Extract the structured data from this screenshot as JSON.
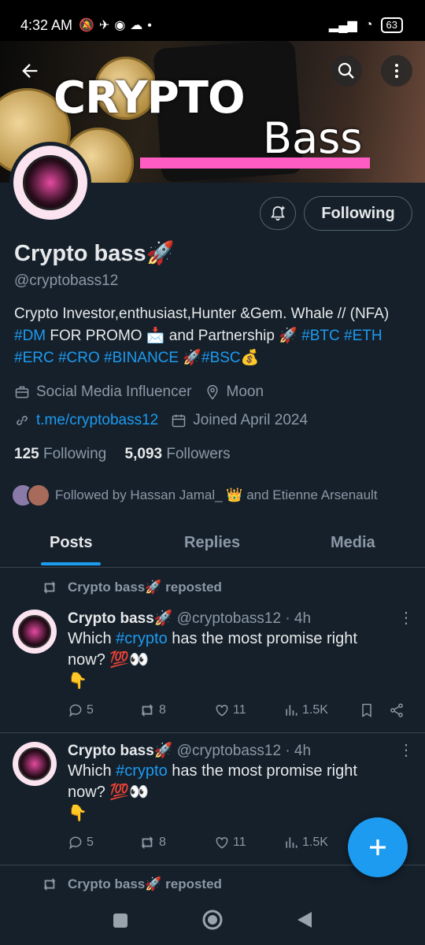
{
  "status": {
    "time": "4:32 AM",
    "battery": "63"
  },
  "banner": {
    "title": "CRYPTO",
    "subtitle": "Bass"
  },
  "profile": {
    "follow_label": "Following",
    "name": "Crypto bass🚀",
    "handle": "@cryptobass12",
    "bio_parts": [
      {
        "t": "Crypto Investor,enthusiast,Hunter &Gem. Whale // (NFA) "
      },
      {
        "t": "#DM",
        "tag": true
      },
      {
        "t": " FOR PROMO 📩 and Partnership 🚀 "
      },
      {
        "t": "#BTC",
        "tag": true
      },
      {
        "t": " "
      },
      {
        "t": "#ETH",
        "tag": true
      },
      {
        "t": " "
      },
      {
        "t": "#ERC",
        "tag": true
      },
      {
        "t": " "
      },
      {
        "t": "#CRO",
        "tag": true
      },
      {
        "t": " "
      },
      {
        "t": "#BINANCE",
        "tag": true
      },
      {
        "t": " 🚀"
      },
      {
        "t": "#BSC",
        "tag": true
      },
      {
        "t": "💰"
      }
    ],
    "category": "Social Media Influencer",
    "location": "Moon",
    "link": "t.me/cryptobass12",
    "joined": "Joined April 2024",
    "following_count": "125",
    "following_label": "Following",
    "followers_count": "5,093",
    "followers_label": "Followers",
    "followed_by": "Followed by Hassan Jamal_ 👑 and Etienne Arsenault"
  },
  "tabs": [
    "Posts",
    "Replies",
    "Media"
  ],
  "reposted_label": "Crypto bass🚀 reposted",
  "posts": [
    {
      "name": "Crypto bass🚀",
      "meta": "@cryptobass12 · 4h",
      "text_before": "Which ",
      "hashtag": "#crypto",
      "text_after": " has the most promise right now? 💯👀",
      "line2": "👇",
      "replies": "5",
      "reposts": "8",
      "likes": "11",
      "views": "1.5K"
    },
    {
      "name": "Crypto bass🚀",
      "meta": "@cryptobass12 · 4h",
      "text_before": "Which ",
      "hashtag": "#crypto",
      "text_after": " has the most promise right now? 💯👀",
      "line2": "👇",
      "replies": "5",
      "reposts": "8",
      "likes": "11",
      "views": "1.5K"
    }
  ],
  "colors": {
    "accent": "#1d9bf0",
    "background": "#15202b",
    "muted": "#8b98a5"
  }
}
